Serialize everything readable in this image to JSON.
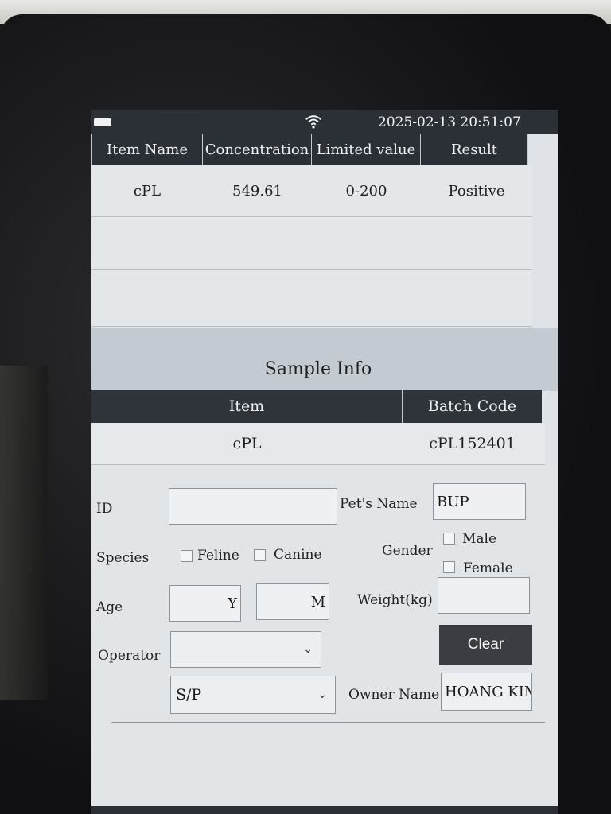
{
  "status": {
    "datetime": "2025-02-13 20:51:07",
    "battery_icon": "battery-icon",
    "wifi_icon": "wifi-icon"
  },
  "results": {
    "headers": [
      "Item Name",
      "Concentration",
      "Limited value",
      "Result"
    ],
    "rows": [
      {
        "item": "cPL",
        "concentration": "549.61",
        "limit": "0-200",
        "result": "Positive"
      },
      {
        "item": "",
        "concentration": "",
        "limit": "",
        "result": ""
      },
      {
        "item": "",
        "concentration": "",
        "limit": "",
        "result": ""
      }
    ]
  },
  "sample": {
    "title": "Sample Info",
    "headers": [
      "Item",
      "Batch Code"
    ],
    "item": "cPL",
    "batch_code": "cPL152401"
  },
  "form": {
    "id_label": "ID",
    "id_value": "",
    "pet_name_label": "Pet's Name",
    "pet_name_value": "BUP",
    "species_label": "Species",
    "species_options": [
      "Feline",
      "Canine"
    ],
    "gender_label": "Gender",
    "gender_options": [
      "Male",
      "Female"
    ],
    "age_label": "Age",
    "age_years": "",
    "age_months": "",
    "age_year_unit": "Y",
    "age_month_unit": "M",
    "weight_label": "Weight(kg)",
    "weight_value": "",
    "operator_label": "Operator",
    "operator_value": "",
    "sample_type_value": "S/P",
    "owner_label": "Owner Name",
    "owner_value": "HOANG KIM",
    "clear_label": "Clear"
  }
}
